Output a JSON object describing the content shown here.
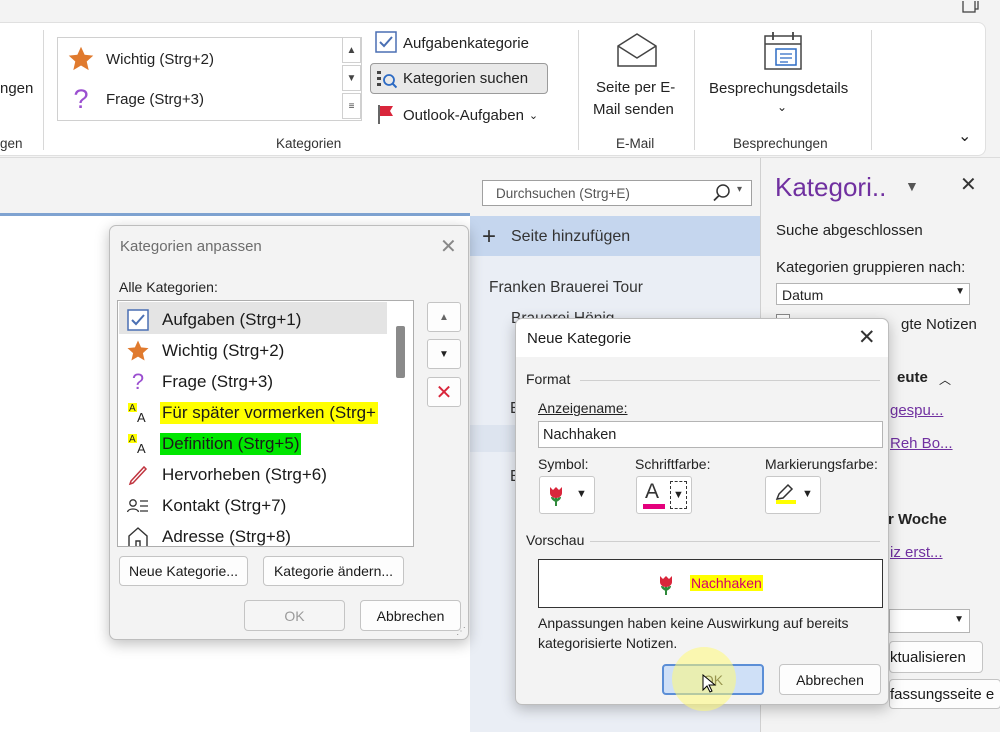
{
  "ribbon": {
    "left_partial_label": "ngen",
    "left_partial_group": "gen",
    "gallery_items": [
      {
        "icon": "star-icon",
        "label": "Wichtig (Strg+2)"
      },
      {
        "icon": "question-icon",
        "label": "Frage (Strg+3)"
      }
    ],
    "aufgabenkategorie": "Aufgabenkategorie",
    "kategorien_suchen": "Kategorien suchen",
    "outlook_aufgaben": "Outlook-Aufgaben",
    "group_kategorien": "Kategorien",
    "email_line1": "Seite per E-",
    "email_line2": "Mail senden",
    "group_email": "E-Mail",
    "besprechungsdetails": "Besprechungsdetails",
    "group_besprechungen": "Besprechungen"
  },
  "search": {
    "placeholder": "Durchsuchen (Strg+E)"
  },
  "pages": {
    "add_page": "Seite hinzufügen",
    "items": [
      "Franken Brauerei Tour",
      "Brauerei Hönig",
      "E",
      "E"
    ]
  },
  "taskpane": {
    "title": "Kategori..",
    "status": "Suche abgeschlossen",
    "group_by_label": "Kategorien gruppieren nach:",
    "group_by_value": "Datum",
    "checkbox_label": "gte Notizen",
    "section_today": "eute",
    "link1": "gespu...",
    "link2": "Reh Bo...",
    "section_week": "r Woche",
    "link3": "iz erst...",
    "btn_refresh": "ktualisieren",
    "btn_summary": "fassungsseite e"
  },
  "dialog1": {
    "title": "Kategorien anpassen",
    "all_label": "Alle Kategorien:",
    "items": [
      {
        "icon": "checkbox-icon",
        "label": "Aufgaben (Strg+1)",
        "highlight": "#e4e4e4"
      },
      {
        "icon": "star-icon",
        "label": "Wichtig (Strg+2)",
        "highlight": ""
      },
      {
        "icon": "question-icon",
        "label": "Frage (Strg+3)",
        "highlight": ""
      },
      {
        "icon": "font-icon",
        "label": "Für später vormerken (Strg+",
        "highlight": "#ffff00"
      },
      {
        "icon": "font-icon",
        "label": "Definition (Strg+5)",
        "highlight": "#00e600"
      },
      {
        "icon": "pen-icon",
        "label": "Hervorheben (Strg+6)",
        "highlight": ""
      },
      {
        "icon": "contact-icon",
        "label": "Kontakt (Strg+7)",
        "highlight": ""
      },
      {
        "icon": "home-icon",
        "label": "Adresse (Strg+8)",
        "highlight": ""
      }
    ],
    "new_button": "Neue Kategorie...",
    "change_button": "Kategorie ändern...",
    "ok_button": "OK",
    "cancel_button": "Abbrechen"
  },
  "dialog2": {
    "title": "Neue Kategorie",
    "format_label": "Format",
    "display_name_label": "Anzeigename:",
    "display_name_value": "Nachhaken",
    "symbol_label": "Symbol:",
    "font_color_label": "Schriftfarbe:",
    "highlight_label": "Markierungsfarbe:",
    "preview_label": "Vorschau",
    "preview_text": "Nachhaken",
    "note": "Anpassungen haben keine Auswirkung auf bereits kategorisierte Notizen.",
    "ok_button": "OK",
    "cancel_button": "Abbrechen",
    "colors": {
      "font": "#e4007c",
      "highlight": "#ffff00",
      "preview_highlight": "#ffff00",
      "preview_text": "#d4006c"
    }
  },
  "colors": {
    "accent": "#7030a0",
    "blue": "#c5d6ee"
  }
}
